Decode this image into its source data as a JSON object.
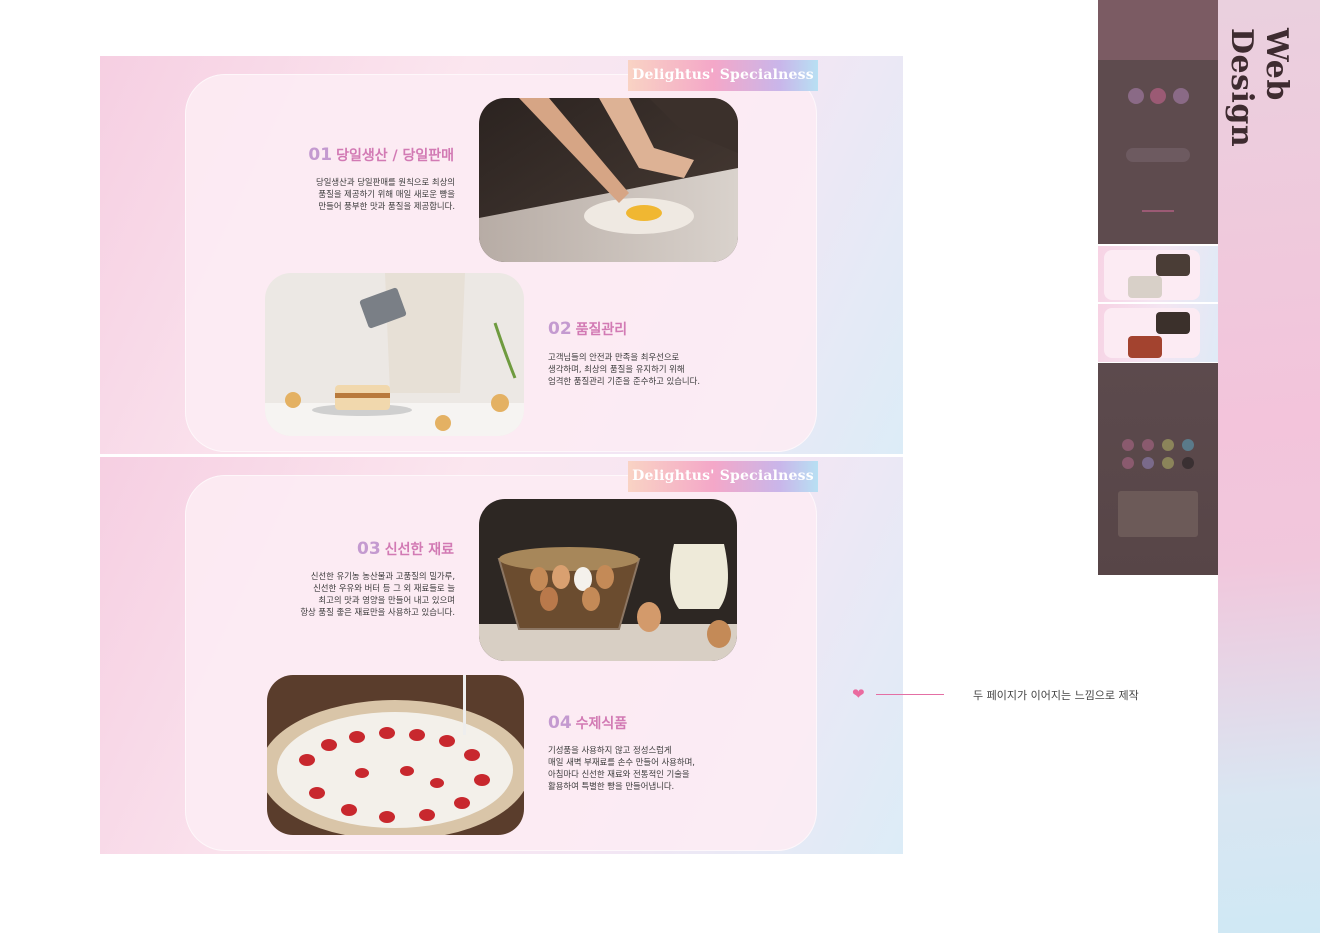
{
  "brand_tag": "Delightus' Specialness",
  "features": [
    {
      "num": "01",
      "title": "당일생산 / 당일판매",
      "body": "당일생산과 당일판매를 원칙으로 최상의\n품질을 제공하기 위해 매일 새로운 빵을\n만들어 풍부한 맛과 품질을 제공합니다."
    },
    {
      "num": "02",
      "title": "품질관리",
      "body": "고객님들의 안전과 만족을 최우선으로\n생각하며, 최상의 품질을 유지하기 위해\n엄격한 품질관리 기준을 준수하고 있습니다."
    },
    {
      "num": "03",
      "title": "신선한 재료",
      "body": "신선한 유기농 농산물과 고품질의 밀가루,\n신선한 우유와 버터 등 그 외 재료들로 늘\n최고의 맛과 영양을 만들어 내고 있으며\n항상 품질 좋은 재료만을 사용하고 있습니다."
    },
    {
      "num": "04",
      "title": "수제식품",
      "body": "기성품을 사용하지 않고 정성스럽게\n매일 새벽 부재료를 손수 만들어 사용하며,\n아침마다 신선한 재료와 전통적인 기술을\n활용하여 특별한 빵을 만들어냅니다."
    }
  ],
  "side_title": "Web Design",
  "annotation": "두 페이지가 이어지는 느낌으로 제작",
  "icons": {
    "annotation_marker": "heart-icon"
  },
  "colors": {
    "accent_pink": "#d27ab4",
    "number_lilac": "#c49ad0",
    "heart": "#ea6b9f"
  }
}
